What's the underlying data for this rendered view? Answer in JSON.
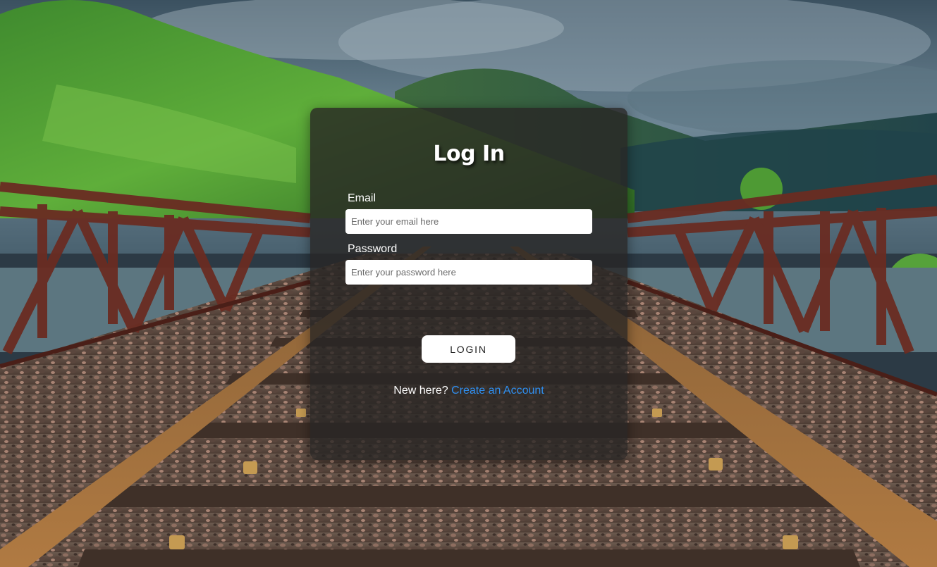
{
  "login": {
    "title": "Log In",
    "email_label": "Email",
    "email_placeholder": "Enter your email here",
    "password_label": "Password",
    "password_placeholder": "Enter your password here",
    "button_label": "LOGIN",
    "signup_prompt": "New here?",
    "signup_link": "Create an Account"
  },
  "colors": {
    "link": "#2f8ff0",
    "card_background": "rgba(40,38,36,0.80)",
    "button_background": "#ffffff"
  }
}
